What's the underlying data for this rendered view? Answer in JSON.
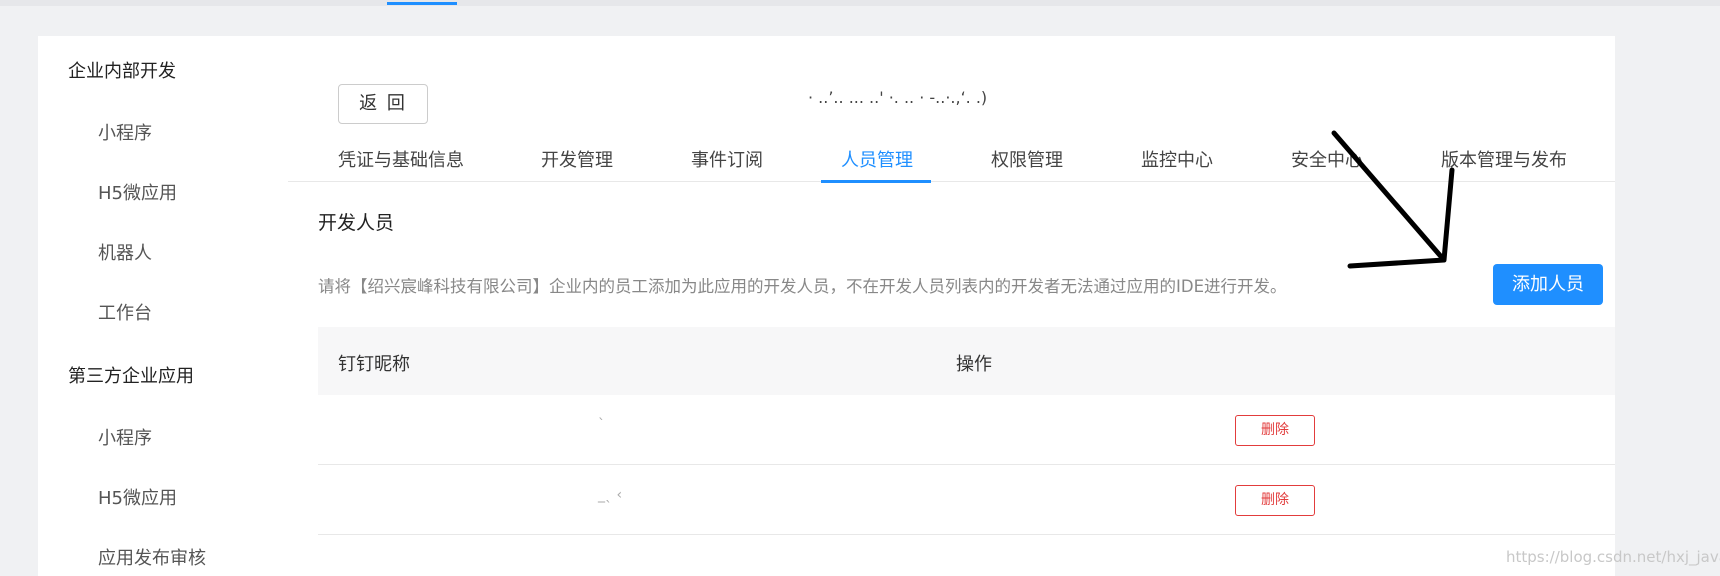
{
  "sidebar": {
    "groups": [
      {
        "title": "企业内部开发",
        "items": [
          "小程序",
          "H5微应用",
          "机器人",
          "工作台"
        ]
      },
      {
        "title": "第三方企业应用",
        "items": [
          "小程序",
          "H5微应用",
          "应用发布审核"
        ]
      }
    ]
  },
  "header": {
    "back_label": "返 回",
    "app_name": "· ..’.. ... ..' ·. .. · -..·.,‘. .)"
  },
  "tabs": [
    {
      "label": "凭证与基础信息"
    },
    {
      "label": "开发管理"
    },
    {
      "label": "事件订阅"
    },
    {
      "label": "人员管理",
      "active": true
    },
    {
      "label": "权限管理"
    },
    {
      "label": "监控中心"
    },
    {
      "label": "安全中心"
    },
    {
      "label": "版本管理与发布"
    }
  ],
  "section": {
    "title": "开发人员",
    "hint": "请将【绍兴宸峰科技有限公司】企业内的员工添加为此应用的开发人员，不在开发人员列表内的开发者无法通过应用的IDE进行开发。",
    "add_button": "添加人员"
  },
  "table": {
    "columns": [
      "钉钉昵称",
      "操作"
    ],
    "rows": [
      {
        "nickname": "`",
        "action": "删除"
      },
      {
        "nickname": "_ˎ  ‹",
        "action": "删除"
      }
    ]
  },
  "watermark": "https://blog.csdn.net/hxj_java",
  "colors": {
    "accent": "#1f8fff",
    "danger": "#e23c3c",
    "background": "#f0f1f3"
  }
}
